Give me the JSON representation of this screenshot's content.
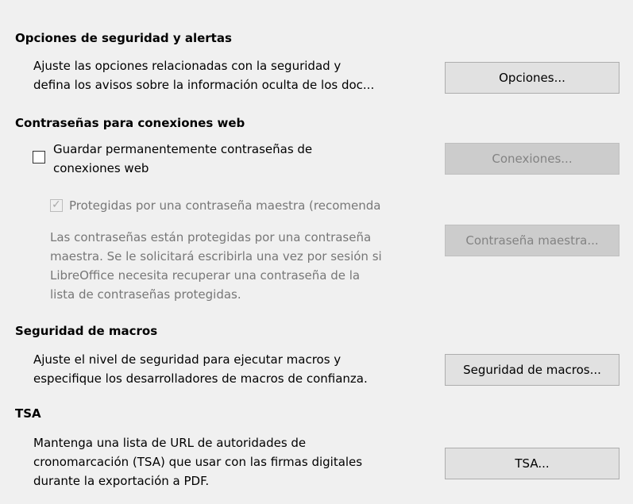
{
  "security_options": {
    "heading": "Opciones de seguridad y alertas",
    "description_lines": [
      "Ajuste las opciones relacionadas con la seguridad y",
      "defina los avisos sobre la información oculta de los doc..."
    ],
    "button_label": "Opciones..."
  },
  "web_passwords": {
    "heading": "Contraseñas para conexiones web",
    "save_checkbox": {
      "label_lines": [
        "Guardar permanentemente contraseñas de",
        "conexiones web"
      ],
      "checked": false
    },
    "connections_button_label": "Conexiones...",
    "master_checkbox": {
      "label": "Protegidas por una contraseña maestra (recomenda",
      "checked": true,
      "enabled": false
    },
    "master_description_lines": [
      "Las contraseñas están protegidas por una contraseña",
      "maestra. Se le solicitará escribirla una vez por sesión si",
      "LibreOffice necesita recuperar una contraseña de la",
      "lista de contraseñas protegidas."
    ],
    "master_password_button_label": "Contraseña maestra..."
  },
  "macro_security": {
    "heading": "Seguridad de macros",
    "description_lines": [
      "Ajuste el nivel de seguridad para ejecutar macros y",
      "especifique los desarrolladores de macros de confianza."
    ],
    "button_label": "Seguridad de macros..."
  },
  "tsa": {
    "heading": "TSA",
    "description_lines": [
      "Mantenga una lista de URL de autoridades de",
      "cronomarcación (TSA) que usar con las firmas digitales",
      "durante la exportación a PDF."
    ],
    "button_label": "TSA..."
  },
  "colors": {
    "background": "#f0f0f0",
    "button_face": "#e1e1e1",
    "button_border": "#adadad",
    "disabled_text": "#777777"
  }
}
